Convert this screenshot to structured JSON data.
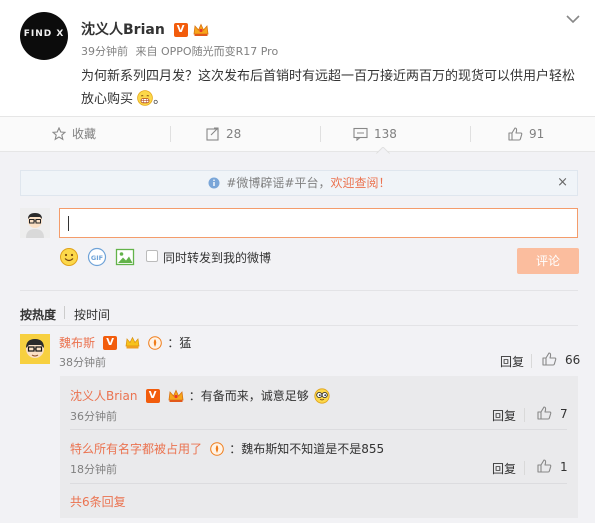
{
  "post": {
    "author": "沈义人Brian",
    "time": "39分钟前",
    "source_prefix": "来自",
    "source": "OPPO随光而变R17 Pro",
    "text": "为何新系列四月发？这次发布后首销时有远超一百万接近两百万的现货可以供用户轻松放心购买",
    "avatar_logo": "FIND X"
  },
  "actions": {
    "favorite": "收藏",
    "repost_count": "28",
    "comment_count": "138",
    "like_count": "91"
  },
  "notice": {
    "prefix": "#微博辟谣#平台，",
    "highlight": "欢迎查阅！",
    "close": "×"
  },
  "composer": {
    "repost_label": "同时转发到我的微博",
    "submit_label": "评论"
  },
  "sort": {
    "hot": "按热度",
    "time": "按时间"
  },
  "comments": [
    {
      "name": "魏布斯",
      "text": "：猛",
      "time": "38分钟前",
      "reply_label": "回复",
      "likes": "66",
      "replies": [
        {
          "name": "沈义人Brian",
          "text": "：有备而来，诚意足够",
          "time": "36分钟前",
          "reply_label": "回复",
          "likes": "7"
        },
        {
          "name": "特么所有名字都被占用了",
          "text": "：魏布斯知不知道是不是855",
          "time": "18分钟前",
          "reply_label": "回复",
          "likes": "1"
        }
      ],
      "total_replies": "共6条回复"
    }
  ],
  "colors": {
    "accent": "#eb7350",
    "v_badge": "#f25c0c",
    "submit_bg": "#fbbd9e",
    "panel_bg": "#f2f2f5"
  }
}
